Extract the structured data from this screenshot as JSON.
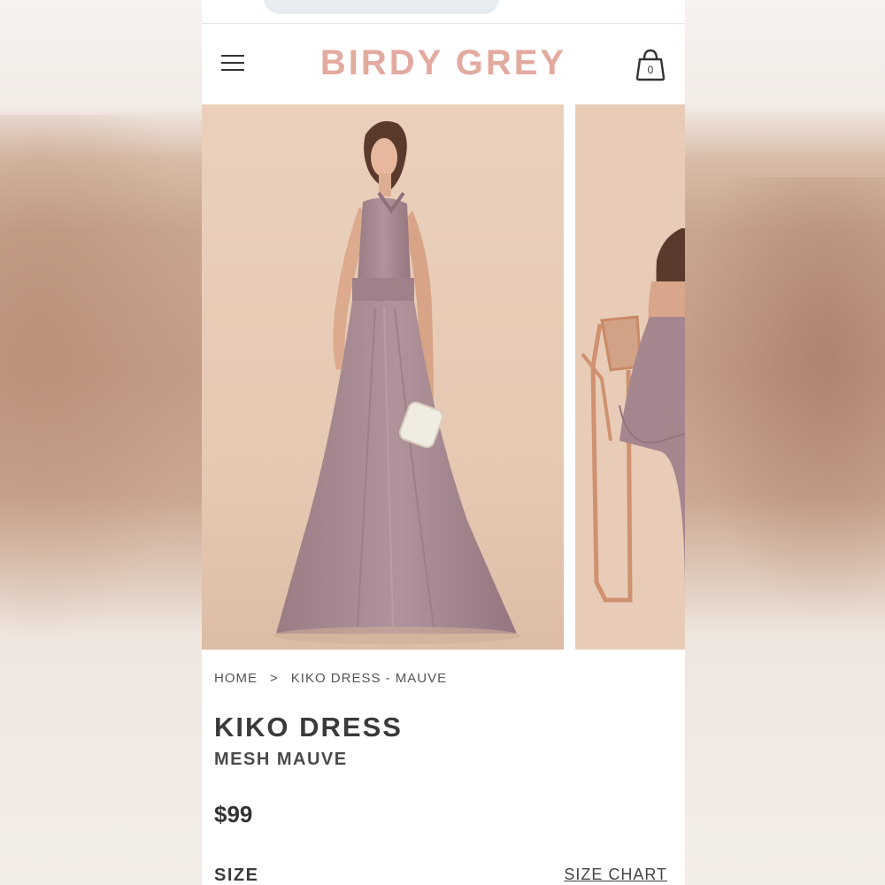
{
  "header": {
    "brand": "BIRDY GREY",
    "cart_count": "0",
    "menu_icon": "hamburger-menu-icon",
    "cart_icon": "shopping-bag-icon"
  },
  "gallery": {
    "slides": [
      "main-product-photo",
      "next-product-photo"
    ]
  },
  "breadcrumb": {
    "home": "HOME",
    "separator": ">",
    "current": "KIKO DRESS - MAUVE"
  },
  "product": {
    "name": "KIKO DRESS",
    "variant": "MESH MAUVE",
    "price": "$99",
    "size_label": "SIZE",
    "size_chart_link": "SIZE CHART"
  },
  "colors": {
    "brand": "#e3aaa0",
    "text": "#3a3a3a",
    "dress": "#a6868e",
    "backdrop": "#e7c9b3"
  }
}
